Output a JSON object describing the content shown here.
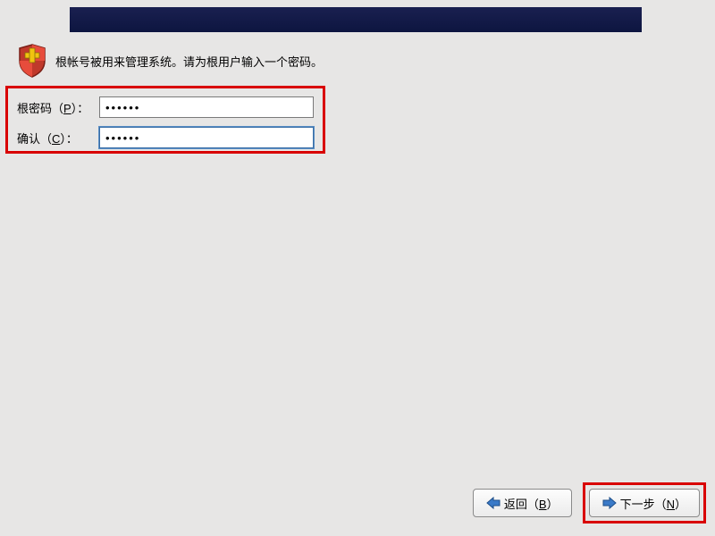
{
  "description": "根帐号被用来管理系统。请为根用户输入一个密码。",
  "form": {
    "password_label_pre": "根密码（",
    "password_mnemonic": "P",
    "password_label_post": "）：",
    "password_value": "••••••",
    "confirm_label_pre": "确认（",
    "confirm_mnemonic": "C",
    "confirm_label_post": "）：",
    "confirm_value": "••••••"
  },
  "buttons": {
    "back_pre": "返回（",
    "back_mnemonic": "B",
    "back_post": "）",
    "next_pre": "下一步（",
    "next_mnemonic": "N",
    "next_post": "）"
  }
}
